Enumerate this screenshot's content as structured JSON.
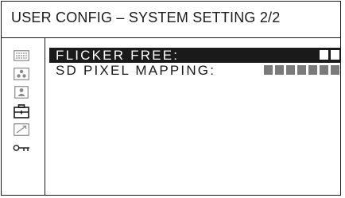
{
  "screen": {
    "title": "USER CONFIG – SYSTEM SETTING 2/2"
  },
  "sidebar": {
    "icons": [
      {
        "name": "grid-dots-icon",
        "selected": false
      },
      {
        "name": "color-dots-icon",
        "selected": false
      },
      {
        "name": "person-icon",
        "selected": false
      },
      {
        "name": "toolbox-icon",
        "selected": true
      },
      {
        "name": "diagonal-arrow-icon",
        "selected": false
      },
      {
        "name": "key-icon",
        "selected": false
      }
    ]
  },
  "menu": {
    "items": [
      {
        "label": "FLICKER FREE:",
        "selected": true,
        "value_segments": 2,
        "value_color": "#ffffff"
      },
      {
        "label": "SD PIXEL MAPPING:",
        "selected": false,
        "value_segments": 7,
        "value_color": "#7a7a7a"
      }
    ]
  },
  "colors": {
    "line": "#1a1a1a",
    "background": "#ffffff",
    "selection": "#1a1a1a",
    "dim_segment": "#7a7a7a"
  }
}
